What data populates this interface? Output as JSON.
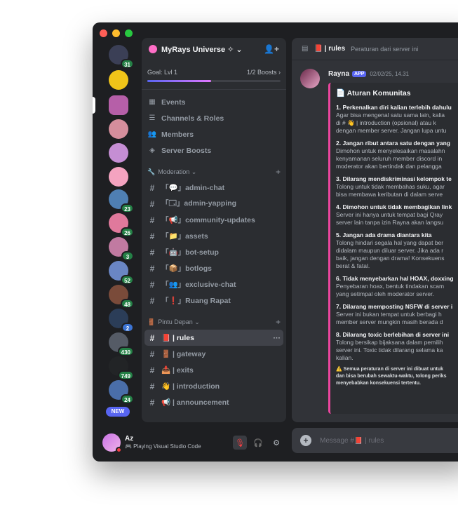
{
  "guild": {
    "name": "MyRays Universe ✧ ⌄"
  },
  "boost": {
    "goal_label": "Goal: Lvl 1",
    "boosts_label": "1/2 Boosts ›",
    "progress": 0.48
  },
  "nav": [
    {
      "label": "Events",
      "icon": "calendar-icon"
    },
    {
      "label": "Channels & Roles",
      "icon": "channels-roles-icon"
    },
    {
      "label": "Members",
      "icon": "members-icon"
    },
    {
      "label": "Server Boosts",
      "icon": "boost-icon"
    }
  ],
  "categories": {
    "moderation": "Moderation ⌄",
    "pintu_depan": "Pintu Depan ⌄"
  },
  "moderation_channels": [
    {
      "label": "「💬」admin-chat"
    },
    {
      "label": "「🗔」admin-yapping"
    },
    {
      "label": "「📢」community-updates"
    },
    {
      "label": "「📁」assets"
    },
    {
      "label": "「🤖」bot-setup"
    },
    {
      "label": "「📦」botlogs"
    },
    {
      "label": "「👥」exclusive-chat"
    },
    {
      "label": "「❗」Ruang Rapat"
    }
  ],
  "pintu_channels": [
    {
      "label": "📕 | rules",
      "active": true
    },
    {
      "label": "🚪 | gateway"
    },
    {
      "label": "📥 | exits"
    },
    {
      "label": "👋 | introduction"
    },
    {
      "label": "📢 | announcement"
    }
  ],
  "servers": [
    {
      "badge": "31",
      "color": "#3b3f56"
    },
    {
      "badge": "",
      "color": "#f0c419"
    },
    {
      "badge": "",
      "color": "#b65fa8",
      "selected": true
    },
    {
      "badge": "",
      "color": "#d58e9c"
    },
    {
      "badge": "",
      "color": "#c58ed4"
    },
    {
      "badge": "",
      "color": "#f4a3c0"
    },
    {
      "badge": "23",
      "color": "#4f7fb3"
    },
    {
      "badge": "26",
      "color": "#e0799c"
    },
    {
      "badge": "3",
      "color": "#c17aa1"
    },
    {
      "badge": "52",
      "color": "#6a86c4"
    },
    {
      "badge": "48",
      "color": "#7a4b3a"
    },
    {
      "badge": "2",
      "color": "#2b3d58",
      "blue": true
    },
    {
      "badge": "430",
      "color": "#555b66"
    },
    {
      "badge": "749",
      "color": "#222426"
    },
    {
      "badge": "24",
      "color": "#4a6ea9"
    }
  ],
  "new_label": "NEW",
  "user": {
    "name": "Az",
    "status": "🎮 Playing Visual Studio Code"
  },
  "topbar": {
    "channel": "📕 | rules",
    "topic": "Peraturan dari server ini"
  },
  "message": {
    "author": "Rayna",
    "app_tag": "APP",
    "time": "02/02/25, 14.31",
    "embed_title": "📄 Aturan Komunitas",
    "rules": [
      {
        "title": "1. Perkenalkan diri kalian terlebih dahulu",
        "lines": [
          "Agar bisa mengenal satu sama lain, kalia",
          "di # 👋 | introduction (opsional) atau k",
          "dengan member server. Jangan lupa untu"
        ]
      },
      {
        "title": "2. Jangan ribut antara satu dengan yang",
        "lines": [
          "Dimohon untuk menyelesaikan masalahn",
          "kenyamanan seluruh member discord in",
          "moderator akan bertindak dan pelangga"
        ]
      },
      {
        "title": "3. Dilarang mendiskriminasi kelompok te",
        "lines": [
          "Tolong untuk tidak membahas suku, agar",
          "bisa membawa keributan di dalam serve"
        ]
      },
      {
        "title": "4. Dimohon untuk tidak membagikan link",
        "lines": [
          "Server ini hanya untuk tempat bagi Qray",
          "server lain tanpa izin Rayna akan langsu"
        ]
      },
      {
        "title": "5. Jangan ada drama diantara kita",
        "lines": [
          "Tolong hindari segala hal yang dapat ber",
          "didalam maupun diluar server. Jika ada r",
          "baik, jangan dengan drama! Konsekuens",
          "berat & fatal."
        ]
      },
      {
        "title": "6. Tidak menyebarkan hal HOAX, doxxing",
        "lines": [
          "Penyebaran hoax, bentuk tindakan scam",
          "yang setimpal oleh moderator server."
        ]
      },
      {
        "title": "7. Dilarang memposting NSFW di server i",
        "lines": [
          "Server ini bukan tempat untuk berbagi h",
          "member server mungkin masih berada d"
        ]
      },
      {
        "title": "8. Dilarang toxic berlebihan di server ini",
        "lines": [
          "Tolong bersikap bijaksana dalam pemilih",
          "server ini. Toxic tidak dilarang selama ka",
          "kalian."
        ]
      }
    ],
    "footnote": [
      "⚠️ Semua peraturan di server ini dibuat untuk",
      "dan bisa berubah sewaktu-waktu, tolong periks",
      "menyebabkan konsekuensi tertentu."
    ]
  },
  "composer": {
    "placeholder": "Message #📕 | rules"
  }
}
